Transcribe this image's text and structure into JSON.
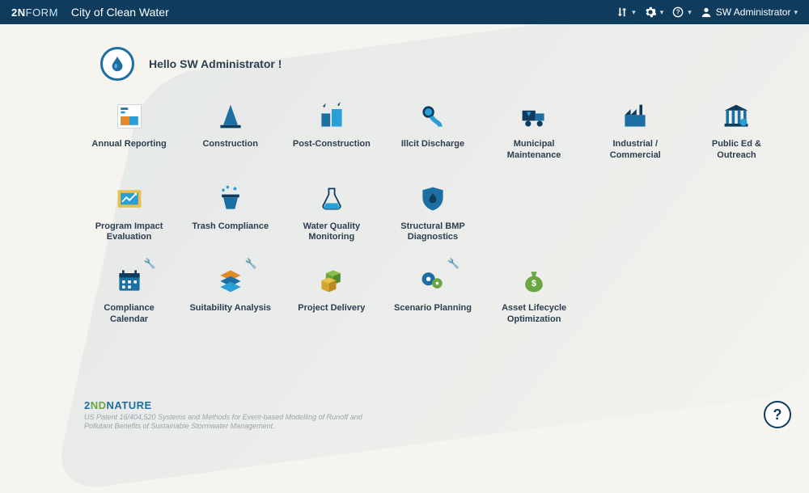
{
  "header": {
    "brand_first": "2N",
    "brand_second": "FORM",
    "org_name": "City of Clean Water",
    "user_name": "SW Administrator"
  },
  "greeting": "Hello SW Administrator !",
  "tiles": [
    {
      "label": "Annual Reporting"
    },
    {
      "label": "Construction"
    },
    {
      "label": "Post-Construction"
    },
    {
      "label": "Illcit Discharge"
    },
    {
      "label": "Municipal Maintenance"
    },
    {
      "label": "Industrial / Commercial"
    },
    {
      "label": "Public Ed & Outreach"
    },
    {
      "label": "Program Impact Evaluation"
    },
    {
      "label": "Trash Compliance"
    },
    {
      "label": "Water Quality Monitoring"
    },
    {
      "label": "Structural BMP Diagnostics"
    },
    {
      "label": "Compliance Calendar"
    },
    {
      "label": "Suitability Analysis"
    },
    {
      "label": "Project Delivery"
    },
    {
      "label": "Scenario Planning"
    },
    {
      "label": "Asset Lifecycle Optimization"
    }
  ],
  "footer": {
    "brand_a": "2",
    "brand_b": "ND",
    "brand_c": "NATURE",
    "patent": "US Patent 16/404,520 Systems and Methods for Event-based Modelling of Runoff and Pollutant Benefits of Sustainable Stormwater Management."
  },
  "help_label": "?"
}
